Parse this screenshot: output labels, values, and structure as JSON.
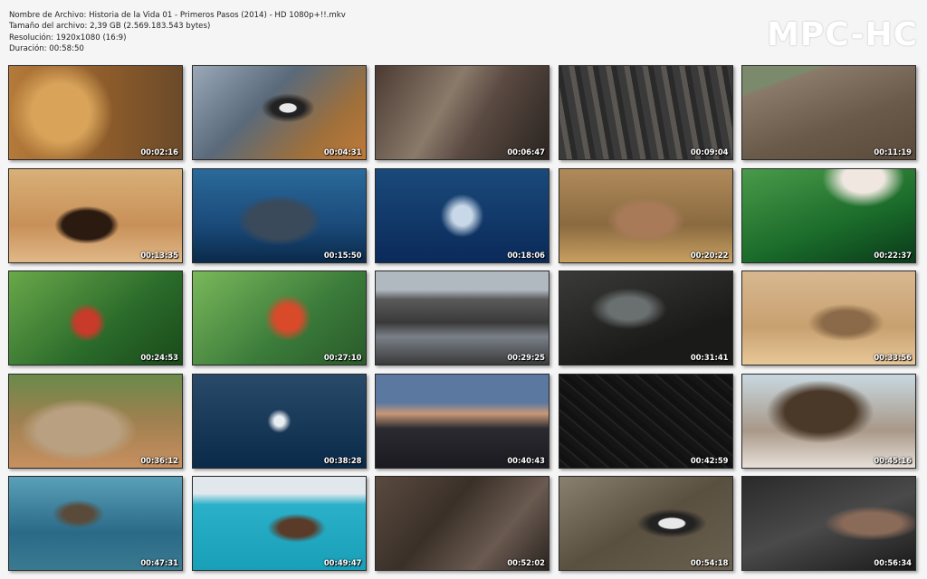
{
  "file_info": {
    "name": "Nombre de Archivo: Historia de la Vida 01 - Primeros Pasos (2014) - HD 1080p+!!.mkv",
    "size": "Tamaño del archivo: 2,39 GB (2.569.183.543 bytes)",
    "resolution": "Resolución: 1920x1080 (16:9)",
    "duration": "Duración: 00:58:50"
  },
  "brand": "MPC-HC",
  "thumbnails": [
    {
      "time": "00:02:16"
    },
    {
      "time": "00:04:31"
    },
    {
      "time": "00:06:47"
    },
    {
      "time": "00:09:04"
    },
    {
      "time": "00:11:19"
    },
    {
      "time": "00:13:35"
    },
    {
      "time": "00:15:50"
    },
    {
      "time": "00:18:06"
    },
    {
      "time": "00:20:22"
    },
    {
      "time": "00:22:37"
    },
    {
      "time": "00:24:53"
    },
    {
      "time": "00:27:10"
    },
    {
      "time": "00:29:25"
    },
    {
      "time": "00:31:41"
    },
    {
      "time": "00:33:56"
    },
    {
      "time": "00:36:12"
    },
    {
      "time": "00:38:28"
    },
    {
      "time": "00:40:43"
    },
    {
      "time": "00:42:59"
    },
    {
      "time": "00:45:16"
    },
    {
      "time": "00:47:31"
    },
    {
      "time": "00:49:47"
    },
    {
      "time": "00:52:02"
    },
    {
      "time": "00:54:18"
    },
    {
      "time": "00:56:34"
    }
  ]
}
